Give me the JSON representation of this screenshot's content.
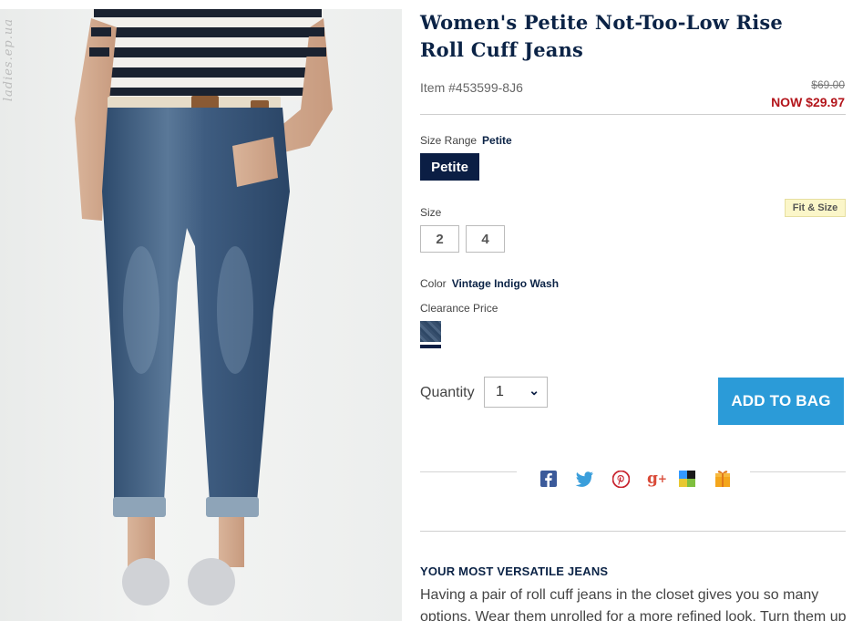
{
  "watermark": "ladies.ep.ua",
  "product": {
    "title": "Women's Petite Not-Too-Low Rise Roll Cuff Jeans",
    "item_number": "Item #453599-8J6",
    "price_was": "$69.00",
    "price_now": "NOW $29.97"
  },
  "size_range": {
    "label": "Size Range",
    "selected": "Petite",
    "button": "Petite"
  },
  "fit_and_size_link": "Fit & Size",
  "size": {
    "label": "Size",
    "options": [
      "2",
      "4"
    ]
  },
  "color": {
    "label": "Color",
    "selected": "Vintage Indigo Wash",
    "price_note": "Clearance Price",
    "swatch_color": "#3a5270"
  },
  "quantity": {
    "label": "Quantity",
    "value": "1"
  },
  "add_to_bag": "ADD TO BAG",
  "social_icons": [
    "facebook-icon",
    "twitter-icon",
    "pinterest-icon",
    "google-plus-icon",
    "delicious-icon",
    "gift-icon"
  ],
  "description": {
    "heading": "YOUR MOST VERSATILE JEANS",
    "body": "Having a pair of roll cuff jeans in the closet gives you so many options. Wear them unrolled for a more refined look. Turn them up"
  },
  "colors": {
    "navy": "#0b1e44",
    "sale_red": "#b3151b",
    "accent_blue": "#2b9bd8",
    "fit_badge": "#fbf6c9"
  }
}
